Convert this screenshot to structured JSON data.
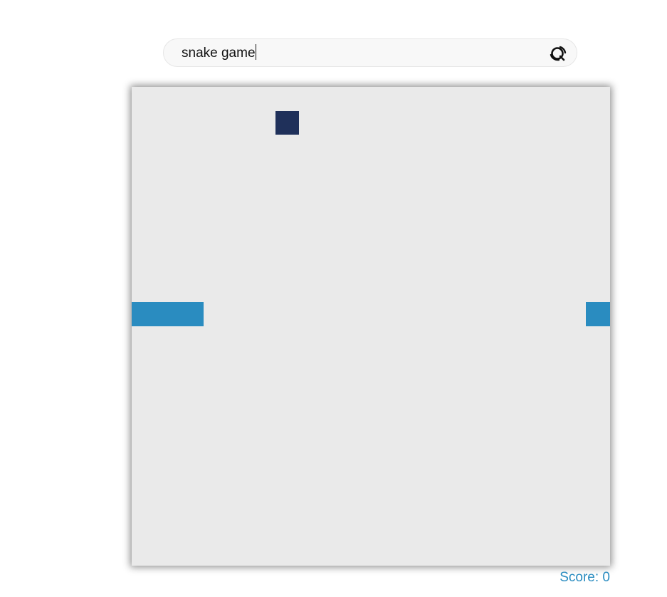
{
  "search": {
    "value": "snake game",
    "icon": "search-icon"
  },
  "game": {
    "grid_size": 20,
    "snake_cells": [
      {
        "col": 0,
        "row": 9
      },
      {
        "col": 1,
        "row": 9
      },
      {
        "col": 2,
        "row": 9
      },
      {
        "col": 19,
        "row": 9
      }
    ],
    "food": {
      "col": 6,
      "row": 1
    },
    "colors": {
      "board": "#eaeaea",
      "snake": "#2a8cc0",
      "food": "#1f305a"
    }
  },
  "score": {
    "text": "Score: 0",
    "color": "#2a8cc0"
  }
}
